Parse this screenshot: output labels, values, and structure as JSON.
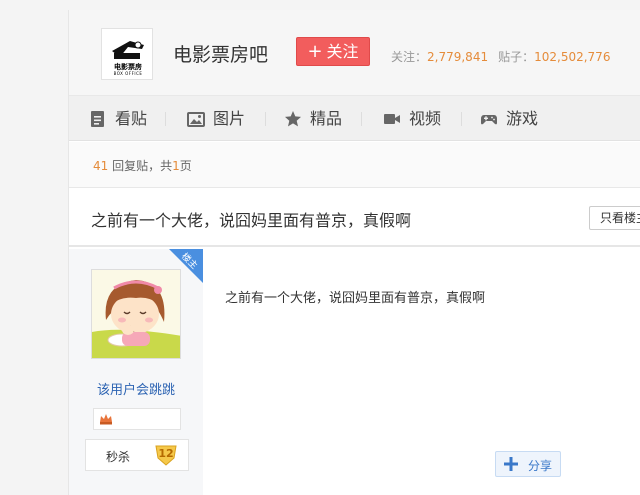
{
  "header": {
    "logo_cn": "电影票房",
    "logo_en": "BOX OFFICE",
    "forum_name": "电影票房吧",
    "follow_label": "关注",
    "follow_prefix": "+",
    "follow_count_label": "关注：",
    "follow_count": "2,779,841",
    "post_count_label": "贴子：",
    "post_count": "102,502,776"
  },
  "tabs": [
    {
      "label": "看贴",
      "icon": "document-icon"
    },
    {
      "label": "图片",
      "icon": "image-icon"
    },
    {
      "label": "精品",
      "icon": "star-icon"
    },
    {
      "label": "视频",
      "icon": "video-icon"
    },
    {
      "label": "游戏",
      "icon": "gamepad-icon"
    }
  ],
  "reply_bar": {
    "reply_count": "41",
    "reply_suffix": " 回复贴，共",
    "page_count": "1",
    "page_suffix": "页"
  },
  "thread": {
    "title": "之前有一个大佬，说囧妈里面有普京，真假啊",
    "only_op_label": "只看楼主"
  },
  "post": {
    "badge": "楼主",
    "username": "该用户会跳跳",
    "level_name": "秒杀",
    "level": "12",
    "content": "之前有一个大佬，说囧妈里面有普京，真假啊",
    "share_label": "分享"
  },
  "colors": {
    "follow_button": "#f25d5d",
    "stat_number": "#e58c3b",
    "username_link": "#2d64b3",
    "op_badge": "#4a8fe0"
  }
}
